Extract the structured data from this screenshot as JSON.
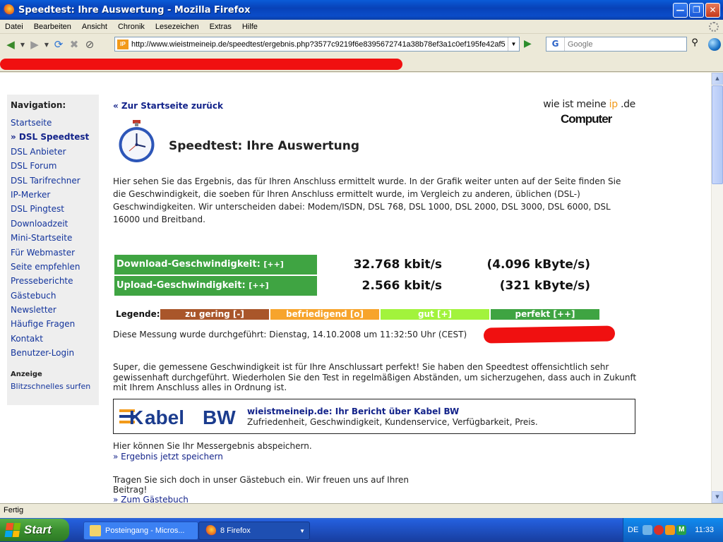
{
  "window": {
    "title": "Speedtest: Ihre Auswertung - Mozilla Firefox"
  },
  "menubar": {
    "items": [
      "Datei",
      "Bearbeiten",
      "Ansicht",
      "Chronik",
      "Lesezeichen",
      "Extras",
      "Hilfe"
    ]
  },
  "navbar": {
    "url": "http://www.wieistmeineip.de/speedtest/ergebnis.php?3577c9219f6e8395672741a38b78ef3a1c0ef195fe42af5",
    "url_badge": "IP",
    "search_engine": "G",
    "search_placeholder": "Google"
  },
  "sidebar": {
    "heading": "Navigation:",
    "items": [
      "Startseite",
      "» DSL Speedtest",
      "DSL Anbieter",
      "DSL Forum",
      "DSL Tarifrechner",
      "IP-Merker",
      "DSL Pingtest",
      "Downloadzeit",
      "Mini-Startseite",
      "Für Webmaster",
      "Seite empfehlen",
      "Presseberichte",
      "Gästebuch",
      "Newsletter",
      "Häufige Fragen",
      "Kontakt",
      "Benutzer-Login"
    ],
    "ad_label": "Anzeige",
    "ad_link": "Blitzschnelles surfen"
  },
  "main": {
    "back_link": "« Zur Startseite zurück",
    "logo_wie": "wie ist meine ",
    "logo_ip": "ip",
    "logo_de": " .de",
    "logo_cb": "Computer",
    "logo_bild": "Bild",
    "title": "Speedtest: Ihre Auswertung",
    "intro": "Hier sehen Sie das Ergebnis, das für Ihren Anschluss ermittelt wurde. In der Grafik weiter unten auf der Seite finden Sie die Geschwindigkeit, die soeben für Ihren Anschluss ermittelt wurde, im Vergleich zu anderen, üblichen (DSL-) Geschwindigkeiten. Wir unterscheiden dabei: Modem/ISDN, DSL 768, DSL 1000, DSL 2000, DSL 3000, DSL 6000, DSL 16000 und Breitband.",
    "results": [
      {
        "label": "Download-Geschwindigkeit:",
        "grade": "[++]",
        "kbit": "32.768 kbit/s",
        "kbyte": "(4.096 kByte/s)"
      },
      {
        "label": "Upload-Geschwindigkeit:",
        "grade": "[++]",
        "kbit": "2.566 kbit/s",
        "kbyte": "(321 kByte/s)"
      }
    ],
    "legend": {
      "label": "Legende:",
      "items": [
        "zu gering [-]",
        "befriedigend [o]",
        "gut [+]",
        "perfekt [++]"
      ],
      "colors": [
        "#a9562a",
        "#f7a42c",
        "#a2f33c",
        "#3fa442"
      ]
    },
    "measured": "Diese Messung wurde durchgeführt: Dienstag, 14.10.2008 um 11:32:50 Uhr (CEST)",
    "verdict": "Super, die gemessene Geschwindigkeit ist für Ihre Anschlussart perfekt! Sie haben den Speedtest offensichtlich sehr gewissenhaft durchgeführt. Wiederholen Sie den Test in regelmäßigen Abständen, um sicherzugehen, dass auch in Zukunft mit Ihrem Anschluss alles in Ordnung ist.",
    "kabel": {
      "logo_k": "K",
      "logo_abel": "abel",
      "logo_bw": "BW",
      "title": "wieistmeineip.de: Ihr Bericht über Kabel BW",
      "subtitle": "Zufriedenheit, Geschwindigkeit, Kundenservice, Verfügbarkeit, Preis."
    },
    "save_text": "Hier können Sie Ihr Messergebnis abspeichern.",
    "save_link": "» Ergebnis jetzt speichern",
    "guest_text": "Tragen Sie sich doch in unser Gästebuch ein. Wir freuen uns auf Ihren Beitrag!",
    "guest_link": "» Zum Gästebuch"
  },
  "statusbar": {
    "text": "Fertig"
  },
  "taskbar": {
    "start": "Start",
    "tasks": [
      "Posteingang - Micros...",
      "8 Firefox"
    ],
    "lang": "DE",
    "time": "11:33"
  }
}
